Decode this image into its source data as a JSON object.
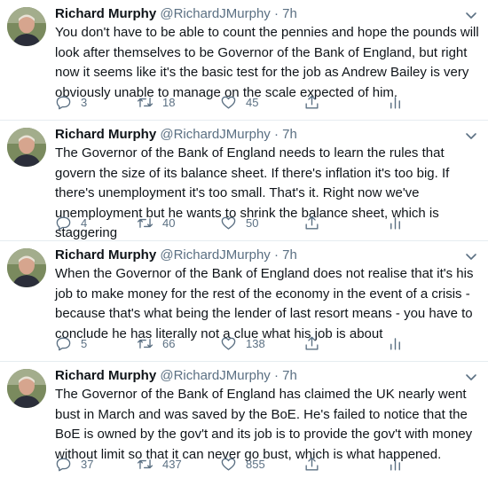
{
  "tweets": [
    {
      "name": "Richard Murphy",
      "handle": "@RichardJMurphy",
      "separator": "·",
      "time": "7h",
      "text": "You don't have to be able to count the pennies and hope the pounds will look after themselves to be Governor of the Bank of England, but right now it seems like it's the basic test for the job as Andrew Bailey is very obviously unable to manage on the scale expected of him.",
      "replies": "3",
      "retweets": "18",
      "likes": "45"
    },
    {
      "name": "Richard Murphy",
      "handle": "@RichardJMurphy",
      "separator": "·",
      "time": "7h",
      "text": "The Governor of the Bank of England needs to learn the rules that govern the size of its balance sheet. If there's inflation it's too big. If there's unemployment it's too small. That's it. Right now we've unemployment but he wants to shrink the balance sheet, which is staggering",
      "replies": "4",
      "retweets": "40",
      "likes": "50"
    },
    {
      "name": "Richard Murphy",
      "handle": "@RichardJMurphy",
      "separator": "·",
      "time": "7h",
      "text": "When the Governor of the Bank of England does not realise that it's his job to make money for the rest of the economy in the event of a crisis - because that's what being the lender of last resort means - you have to conclude he has literally not a clue what his job is about",
      "replies": "5",
      "retweets": "66",
      "likes": "138"
    },
    {
      "name": "Richard Murphy",
      "handle": "@RichardJMurphy",
      "separator": "·",
      "time": "7h",
      "text": "The Governor of the Bank of England has claimed the UK nearly went bust in March and was saved by the BoE. He's failed to notice that the BoE is owned by the gov't and its job is to provide the gov't with money without limit so that it can never go bust, which is what happened.",
      "replies": "37",
      "retweets": "437",
      "likes": "855"
    }
  ],
  "icons": {
    "reply": "reply-icon",
    "retweet": "retweet-icon",
    "like": "heart-icon",
    "share": "share-icon",
    "stats": "analytics-icon",
    "more": "chevron-down-icon"
  },
  "colors": {
    "text": "#0f1419",
    "muted": "#5b7083",
    "divider": "#e6ecf0"
  }
}
